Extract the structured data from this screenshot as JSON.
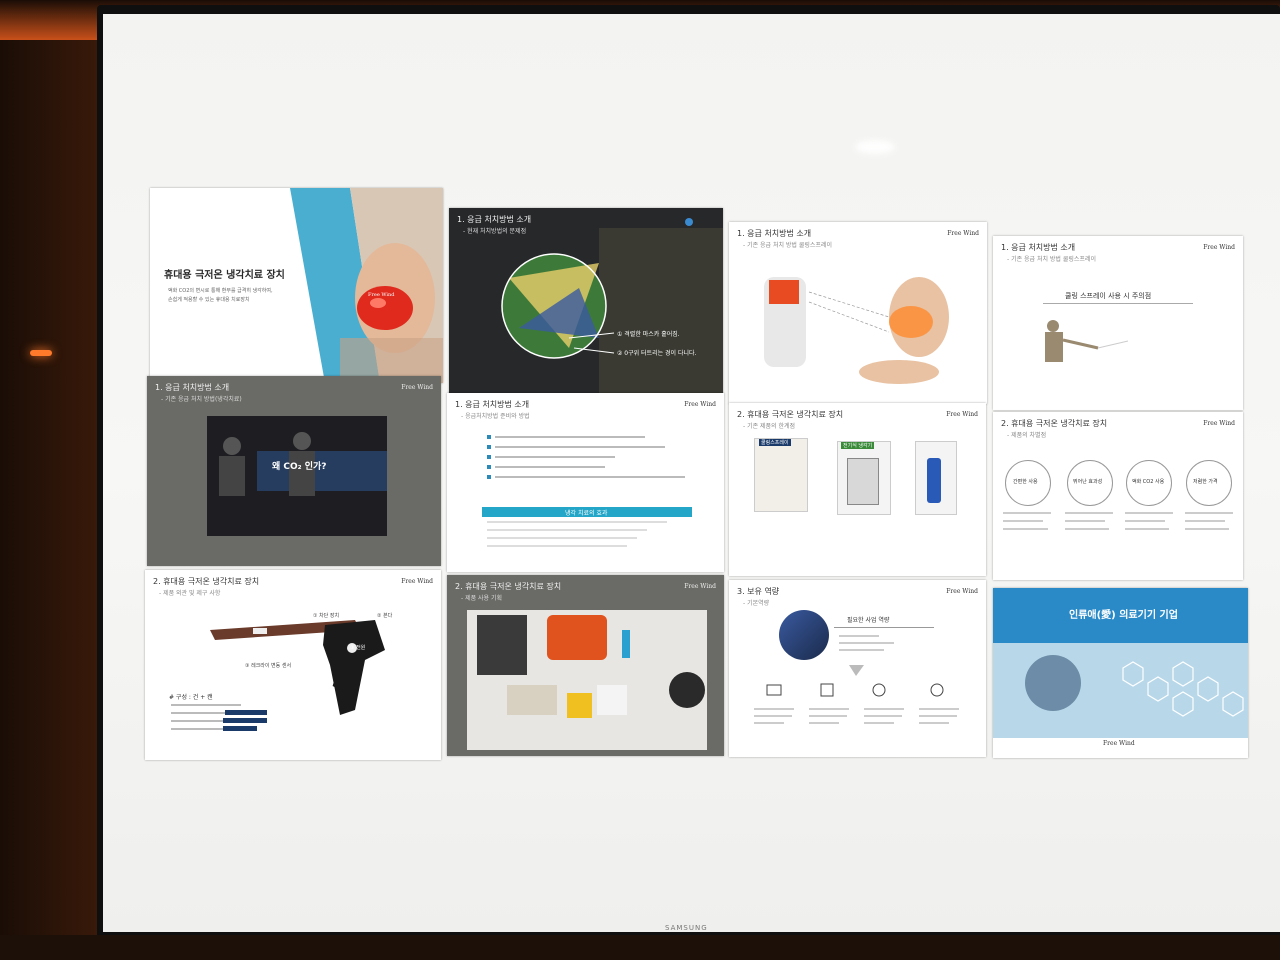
{
  "slides": {
    "s1": {
      "title": "휴대용 극저온 냉각치료 장치",
      "body1": "액화 CO2의 변시로 통해 환부를 급격히 냉각하여,",
      "body2": "손쉽게 적용할 수 있는 휴대용 치료장치",
      "logo": "Free Wind"
    },
    "s2": {
      "title": "1. 응급 처치방법 소개",
      "sub": "- 현재 처치방법의 문제점",
      "note1": "① 격렬한 마스카 흩어짐.",
      "note2": "② 0구위 터트리는 경이 다니다."
    },
    "s3": {
      "title": "1. 응급 처치방법 소개",
      "sub": "- 기존 응급 처치 방법 쿨링스프레이",
      "logo": "Free Wind"
    },
    "s4": {
      "title": "1. 응급 처치방법 소개",
      "sub": "- 기존 응급 처치 방법 쿨링스프레이",
      "heading": "쿨링 스프레이 사용 시 주의점",
      "logo": "Free Wind"
    },
    "s5": {
      "title": "1. 응급 처치방법 소개",
      "sub": "- 기존 응급 처치 방법(냉각치료)",
      "banner": "왜 CO₂ 인가?",
      "logo": "Free Wind"
    },
    "s6": {
      "title": "1. 응급 처치방법 소개",
      "sub": "- 응급처치방법 준비와 방법",
      "box": "냉각 치료의 효과",
      "logo": "Free Wind"
    },
    "s7": {
      "title": "2. 휴대용 극저온 냉각치료 장치",
      "sub": "- 기존 제품의 한계점",
      "label1": "쿨링스프레이",
      "label2": "전기식 냉각기",
      "logo": "Free Wind"
    },
    "s8": {
      "title": "2. 휴대용 극저온 냉각치료 장치",
      "sub": "- 제품의 차별점",
      "c1": "간편한 사용",
      "c2": "뛰어난 효과성",
      "c3": "액화 CO2 사용",
      "c4": "저렴한 가격",
      "logo": "Free Wind"
    },
    "s9": {
      "title": "2. 휴대용 극저온 냉각치료 장치",
      "sub": "- 제품 외관 및 제구 사항",
      "part1": "① 차단 장치",
      "part2": "② 본다",
      "part3": "③ 전원",
      "part4": "③ 레크라이 변동 센서",
      "spec": "# 구성 : 건 + 캔",
      "logo": "Free Wind"
    },
    "s10": {
      "title": "2. 휴대용 극저온 냉각치료 장치",
      "sub": "- 제품 사용 기획",
      "logo": "Free Wind"
    },
    "s11": {
      "title": "3. 보유 역량",
      "sub": "- 기본역량",
      "heading": "필요한 사업 역량",
      "logo": "Free Wind"
    },
    "s12": {
      "title": "인류애(愛) 의료기기 기업",
      "logo": "Free Wind"
    }
  },
  "monitor_brand": "SAMSUNG",
  "colors": {
    "accent": "#1f5aa6",
    "red": "#d63a2a",
    "cyan": "#23a6c7"
  }
}
